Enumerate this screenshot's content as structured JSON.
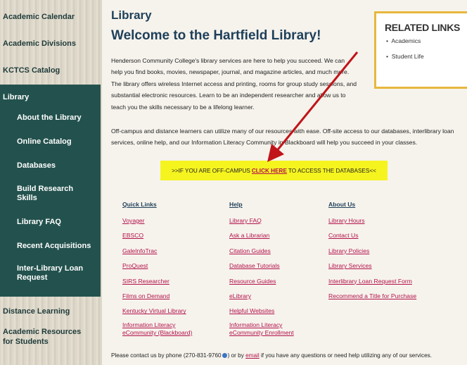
{
  "sidebar": {
    "top_items": [
      "Academic Calendar",
      "Academic Divisions",
      "KCTCS Catalog"
    ],
    "library_heading": "Library",
    "library_items": [
      "About the Library",
      "Online Catalog",
      "Databases",
      "Build Research Skills",
      "Library FAQ",
      "Recent Acquisitions",
      "Inter-Library Loan Request"
    ],
    "bottom_items": [
      "Distance Learning",
      "Academic Resources for Students"
    ]
  },
  "page": {
    "title": "Library",
    "welcome": "Welcome to the Hartfield Library!",
    "intro": "Henderson Community College's library services are here to help you succeed. We can help you find books, movies, newspaper, journal, and magazine articles, and much more. The library offers wireless Internet access and printing, rooms for group study sessions, and substantial electronic resources. Learn to be an independent researcher and allow us to teach you the skills necessary to be a lifelong learner.",
    "para2": "Off-campus and distance learners can utilize many of our resources with ease. Off-site access to our databases, interlibrary loan services, online help, and our Information Literacy Community in Blackboard will help you succeed in your classes.",
    "offcampus_prefix": ">>IF YOU ARE OFF-CAMPUS",
    "offcampus_link": "CLICK HERE",
    "offcampus_suffix": "TO ACCESS THE DATABASES<<"
  },
  "related": {
    "title": "RELATED LINKS",
    "items": [
      "Academics",
      "Student Life"
    ]
  },
  "columns": {
    "quick": {
      "heading": "Quick Links",
      "links": [
        "Voyager",
        "EBSCO",
        "GaleInfoTrac",
        "ProQuest",
        "SIRS Researcher",
        "Films on Demand",
        "Kentucky Virtual Library",
        "Information Literacy eCommunity (Blackboard)"
      ]
    },
    "help": {
      "heading": "Help",
      "links": [
        "Library FAQ",
        "Ask a Librarian",
        "Citation Guides",
        "Database Tutorials",
        "Resource Guides",
        "eLibrary",
        "Helpful Websites",
        "Information Literacy eCommunity Enrollment"
      ]
    },
    "about": {
      "heading": "About Us",
      "links": [
        "Library Hours",
        "Contact Us",
        "Library Policies",
        "Library Services",
        "Interlibrary Loan Request Form",
        "Recommend a Title for Purchase"
      ]
    }
  },
  "footer": {
    "prefix": "Please contact us by phone (270-831-9760",
    "mid": ") or by",
    "email_link": "email",
    "suffix": "if you have any questions or need help utilizing any of our services."
  },
  "colors": {
    "sidebar_active": "#23524e",
    "link": "#b3124d",
    "heading": "#1e3f5a",
    "highlight": "#f6f41f",
    "related_border": "#e8b73d",
    "arrow": "#c0141a"
  }
}
